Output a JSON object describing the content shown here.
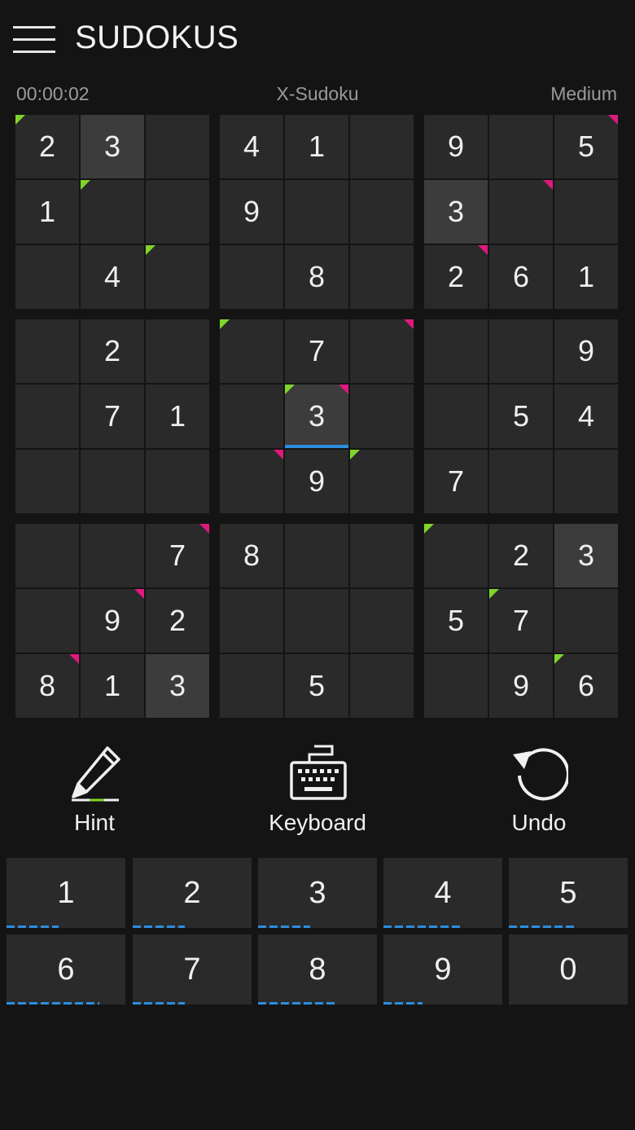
{
  "header": {
    "title": "SUDOKUS",
    "menu_icon": "hamburger-menu-icon"
  },
  "status": {
    "timer": "00:00:02",
    "mode": "X-Sudoku",
    "difficulty": "Medium"
  },
  "grid": [
    [
      "2",
      "3",
      "",
      "4",
      "1",
      "",
      "9",
      "",
      "5"
    ],
    [
      "1",
      "",
      "",
      "9",
      "",
      "",
      "3",
      "",
      ""
    ],
    [
      "",
      "4",
      "",
      "",
      "8",
      "",
      "2",
      "6",
      "1"
    ],
    [
      "",
      "2",
      "",
      "",
      "7",
      "",
      "",
      "",
      "9"
    ],
    [
      "",
      "7",
      "1",
      "",
      "3",
      "",
      "",
      "5",
      "4"
    ],
    [
      "",
      "",
      "",
      "",
      "9",
      "",
      "7",
      "",
      ""
    ],
    [
      "",
      "",
      "7",
      "8",
      "",
      "",
      "",
      "2",
      "3"
    ],
    [
      "",
      "9",
      "2",
      "",
      "",
      "",
      "5",
      "7",
      ""
    ],
    [
      "8",
      "1",
      "3",
      "",
      "5",
      "",
      "",
      "9",
      "6"
    ]
  ],
  "highlighted_cells": [
    [
      0,
      1
    ],
    [
      1,
      6
    ],
    [
      4,
      4
    ],
    [
      6,
      8
    ],
    [
      8,
      2
    ]
  ],
  "selected_cell": [
    4,
    4
  ],
  "green_markers": [
    [
      0,
      0
    ],
    [
      1,
      1
    ],
    [
      2,
      2
    ],
    [
      3,
      3
    ],
    [
      4,
      4
    ],
    [
      5,
      5
    ],
    [
      6,
      6
    ],
    [
      7,
      7
    ],
    [
      8,
      8
    ]
  ],
  "pink_markers": [
    [
      0,
      8
    ],
    [
      1,
      7
    ],
    [
      2,
      6
    ],
    [
      3,
      5
    ],
    [
      4,
      4
    ],
    [
      5,
      3
    ],
    [
      6,
      2
    ],
    [
      7,
      1
    ],
    [
      8,
      0
    ]
  ],
  "colors": {
    "background": "#141414",
    "cell": "#2a2a2a",
    "highlight": "#3c3c3c",
    "accent_blue": "#2d8de0",
    "diag_green": "#7fd62a",
    "diag_pink": "#e0187f"
  },
  "tools": [
    {
      "label": "Hint",
      "icon": "pencil-icon"
    },
    {
      "label": "Keyboard",
      "icon": "keyboard-icon"
    },
    {
      "label": "Undo",
      "icon": "undo-icon"
    }
  ],
  "keypad": [
    {
      "digit": "1",
      "progress": 0.44
    },
    {
      "digit": "2",
      "progress": 0.44
    },
    {
      "digit": "3",
      "progress": 0.44
    },
    {
      "digit": "4",
      "progress": 0.67
    },
    {
      "digit": "5",
      "progress": 0.56
    },
    {
      "digit": "6",
      "progress": 0.78
    },
    {
      "digit": "7",
      "progress": 0.44
    },
    {
      "digit": "8",
      "progress": 0.67
    },
    {
      "digit": "9",
      "progress": 0.33
    },
    {
      "digit": "0",
      "progress": 0
    }
  ]
}
